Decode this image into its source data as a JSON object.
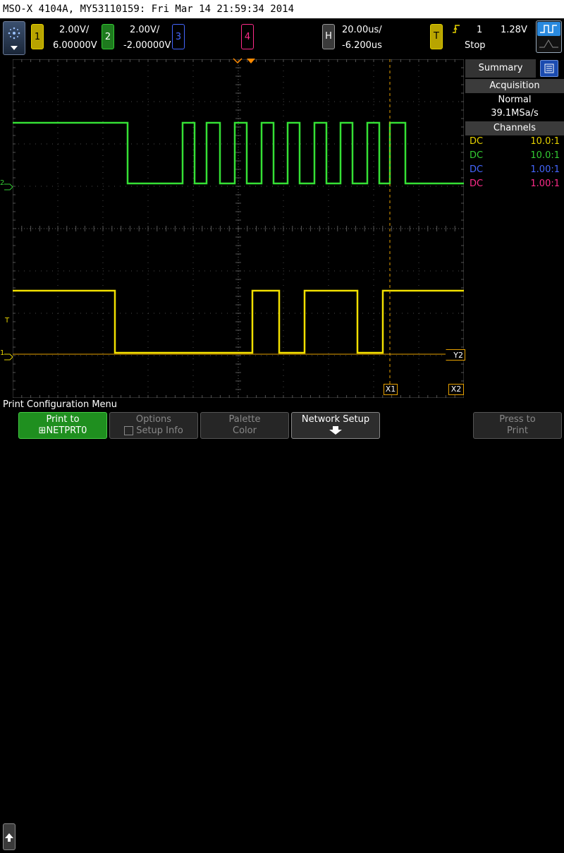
{
  "title": "MSO-X 4104A, MY53110159: Fri Mar 14 21:59:34 2014",
  "channels": [
    {
      "num": "1",
      "scale": "2.00V/",
      "offset": "6.00000V",
      "color": "#e6d200"
    },
    {
      "num": "2",
      "scale": "2.00V/",
      "offset": "-2.00000V",
      "color": "#33cc33"
    },
    {
      "num": "3",
      "color": "#4466ff"
    },
    {
      "num": "4",
      "color": "#ff2b8a"
    }
  ],
  "horizontal": {
    "label": "H",
    "timebase": "20.00us/",
    "delay": "-6.200us"
  },
  "trigger": {
    "label": "T",
    "source": "1",
    "level": "1.28V",
    "state": "Stop",
    "edge_icon": "rising-edge-icon"
  },
  "sidebar": {
    "summary_tab": "Summary",
    "acquisition_header": "Acquisition",
    "acq_mode": "Normal",
    "sample_rate": "39.1MSa/s",
    "channels_header": "Channels",
    "channel_rows": [
      {
        "coupling": "DC",
        "probe": "10.0:1",
        "color": "#e6d200"
      },
      {
        "coupling": "DC",
        "probe": "10.0:1",
        "color": "#33cc33"
      },
      {
        "coupling": "DC",
        "probe": "1.00:1",
        "color": "#4466ff"
      },
      {
        "coupling": "DC",
        "probe": "1.00:1",
        "color": "#ff2b8a"
      }
    ]
  },
  "markers": {
    "ch2_ground": "2",
    "trigger_level": "T",
    "ch1_ground": "1",
    "cursor_y2": "Y2",
    "cursor_x1": "X1",
    "cursor_x2": "X2"
  },
  "menu": {
    "title": "Print Configuration Menu",
    "buttons": [
      {
        "top": "Print to",
        "bottom": "NETPRT0",
        "state": "active"
      },
      {
        "top": "Options",
        "bottom": "Setup Info",
        "state": "disabled"
      },
      {
        "top": "Palette",
        "bottom": "Color",
        "state": "disabled"
      },
      {
        "top": "Network Setup",
        "bottom": "",
        "state": "bright"
      },
      {
        "top": "Press to",
        "bottom": "Print",
        "state": "disabled"
      }
    ]
  }
}
